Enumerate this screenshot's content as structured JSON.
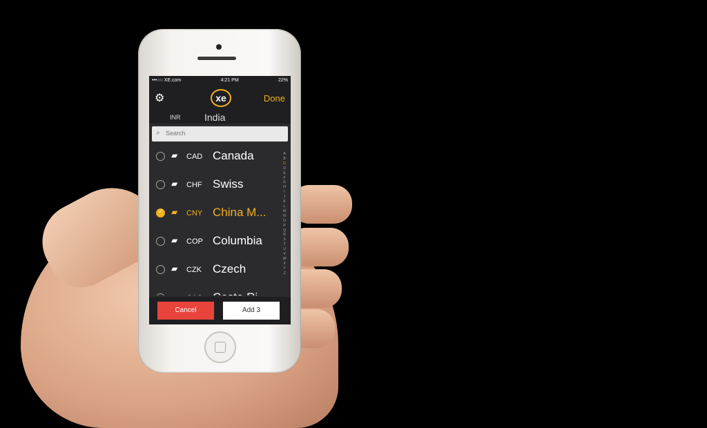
{
  "status_bar": {
    "carrier": "•••○○ XE.com",
    "time": "4:21 PM",
    "battery": "22%"
  },
  "nav": {
    "done_label": "Done",
    "logo_text": "xe"
  },
  "base_currency": {
    "code": "INR",
    "name": "India"
  },
  "search": {
    "placeholder": "Search"
  },
  "currencies": [
    {
      "code": "CAD",
      "name": "Canada",
      "selected": false
    },
    {
      "code": "CHF",
      "name": "Swiss",
      "selected": false
    },
    {
      "code": "CNY",
      "name": "China M...",
      "selected": true
    },
    {
      "code": "COP",
      "name": "Columbia",
      "selected": false
    },
    {
      "code": "CZK",
      "name": "Czech",
      "selected": false
    },
    {
      "code": "CAC",
      "name": "Costa Ri",
      "selected": false
    }
  ],
  "alphabet_index": [
    "A",
    "B",
    "C",
    "D",
    "E",
    "F",
    "G",
    "H",
    "I",
    "J",
    "K",
    "L",
    "M",
    "N",
    "O",
    "P",
    "Q",
    "R",
    "S",
    "T",
    "U",
    "V",
    "W",
    "X",
    "Y",
    "Z"
  ],
  "active_letter": "C",
  "buttons": {
    "cancel": "Cancel",
    "add": "Add 3"
  },
  "colors": {
    "accent": "#f2b01e",
    "cancel": "#e8443b",
    "screen_bg": "#2b2b2d"
  }
}
